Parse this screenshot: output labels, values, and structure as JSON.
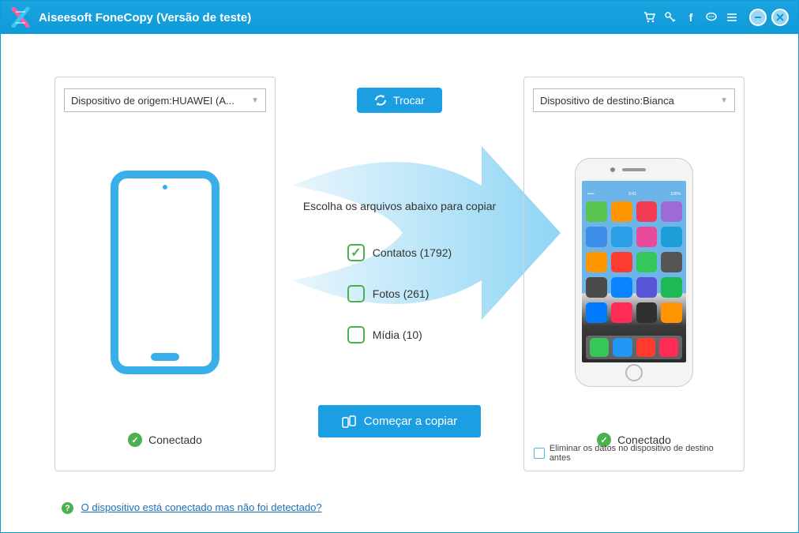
{
  "titlebar": {
    "title": "Aiseesoft FoneCopy (Versão de teste)"
  },
  "source": {
    "dropdown": "Dispositivo de origem:HUAWEI (A...",
    "status": "Conectado"
  },
  "target": {
    "dropdown": "Dispositivo de destino:Bianca",
    "status": "Conectado",
    "eliminate": "Eliminar os datos no dispositivo de destino antes"
  },
  "center": {
    "swap": "Trocar",
    "instruction": "Escolha os arquivos abaixo para copiar",
    "opt_contacts": "Contatos (1792)",
    "opt_photos": "Fotos (261)",
    "opt_media": "Mídia (10)",
    "copy": "Começar a copiar"
  },
  "help": {
    "text": "O dispositivo está conectado mas não foi detectado?"
  },
  "iphone_apps": [
    "#5ac451",
    "#fe9500",
    "#f23b53",
    "#9e6bd6",
    "#3c8ee8",
    "#2b9ee8",
    "#e84b9b",
    "#1c9fd8",
    "#ff9500",
    "#fe3b30",
    "#34c759",
    "#555555",
    "#4b4b4b",
    "#0a84ff",
    "#5856d6",
    "#1db954",
    "#007aff",
    "#ff2d55",
    "#303030",
    "#ff9500"
  ],
  "iphone_dock": [
    "#35c759",
    "#2196f3",
    "#ff3b30",
    "#ff2d55"
  ]
}
